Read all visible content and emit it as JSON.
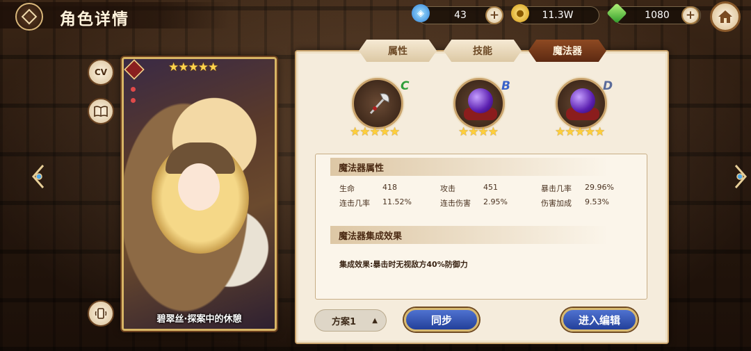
{
  "header": {
    "title": "角色详情",
    "resources": [
      {
        "icon": "water-drop-icon",
        "value": "43",
        "color": "#5bb8ff"
      },
      {
        "icon": "gold-coin-icon",
        "value": "11.3W",
        "color": "#f1c232"
      },
      {
        "icon": "green-gem-icon",
        "value": "1080",
        "color": "#6cd44a"
      }
    ]
  },
  "side_buttons": {
    "cv_label": "CV"
  },
  "card": {
    "stars": "★★★★★",
    "name": "碧翠丝·探案中的休憩"
  },
  "tabs": {
    "attributes": "属性",
    "skills": "技能",
    "magic_item": "魔法器"
  },
  "magic_items": [
    {
      "grade": "C",
      "stars": "★★★★★",
      "grade_color": "#2f9e3a"
    },
    {
      "grade": "B",
      "stars": "★★★★",
      "grade_color": "#3a63c9"
    },
    {
      "grade": "D",
      "stars": "★★★★★",
      "grade_color": "#5a6b9a"
    }
  ],
  "attributes_section": {
    "title": "魔法器属性",
    "stats": [
      {
        "label": "生命",
        "value": "418"
      },
      {
        "label": "攻击",
        "value": "451"
      },
      {
        "label": "暴击几率",
        "value": "29.96%"
      },
      {
        "label": "连击几率",
        "value": "11.52%"
      },
      {
        "label": "连击伤害",
        "value": "2.95%"
      },
      {
        "label": "伤害加成",
        "value": "9.53%"
      }
    ]
  },
  "set_section": {
    "title": "魔法器集成效果",
    "effect": "集成效果:暴击时无视敌方40%防御力"
  },
  "footer": {
    "plan_label": "方案1",
    "plan_caret": "▲",
    "sync_label": "同步",
    "edit_label": "进入编辑"
  }
}
